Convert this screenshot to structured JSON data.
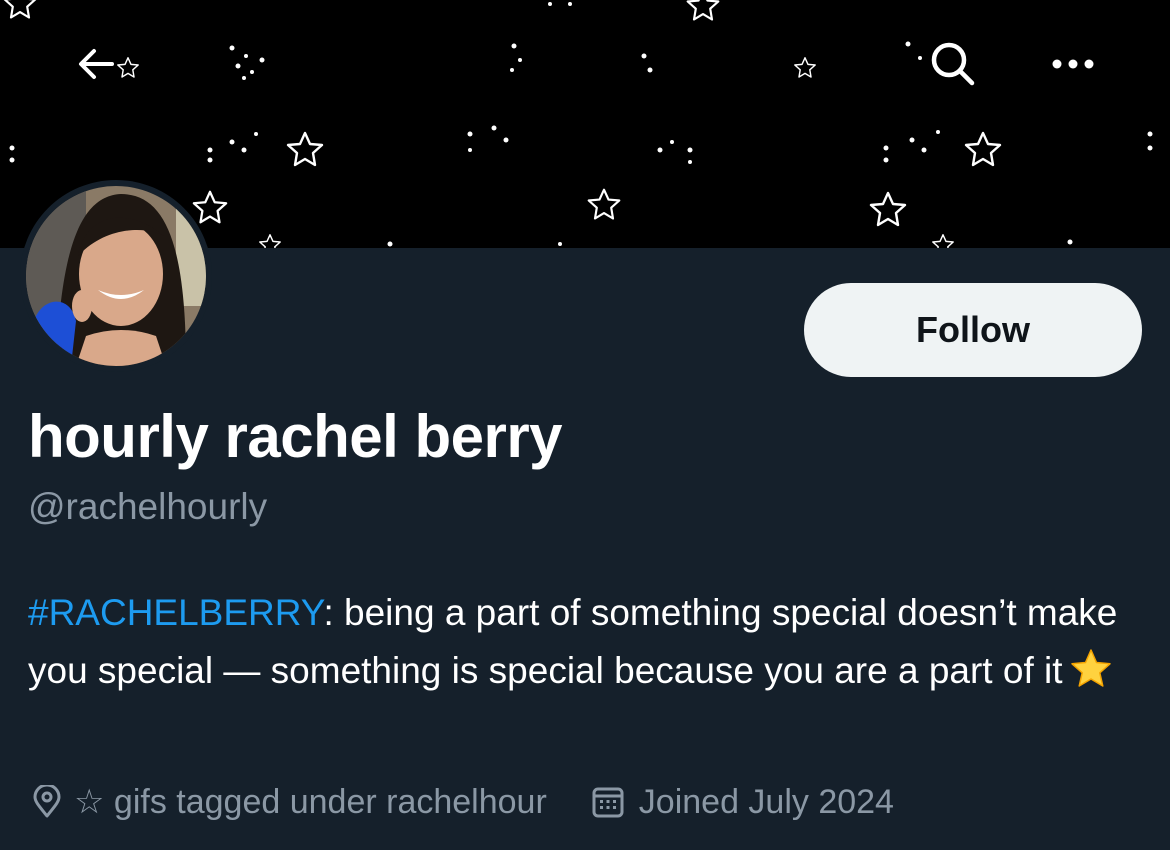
{
  "header": {
    "back_icon": "arrow-left-icon",
    "search_icon": "search-icon",
    "more_icon": "ellipsis-icon"
  },
  "profile": {
    "follow_label": "Follow",
    "display_name": "hourly rachel berry",
    "handle": "@rachelhourly",
    "bio": {
      "hashtag": "#RACHELBERRY",
      "text": ": being a part of something special doesn’t make you special — something is special because you are a part of it",
      "emoji": "star-emoji"
    },
    "location": "☆ gifs tagged under rachelhour",
    "location_icon": "location-pin-icon",
    "joined": "Joined July 2024",
    "joined_icon": "calendar-icon"
  },
  "colors": {
    "background": "#15202b",
    "banner": "#000000",
    "link": "#1d9bf0",
    "secondary_text": "#8b98a5",
    "follow_button": "#eff3f4"
  }
}
